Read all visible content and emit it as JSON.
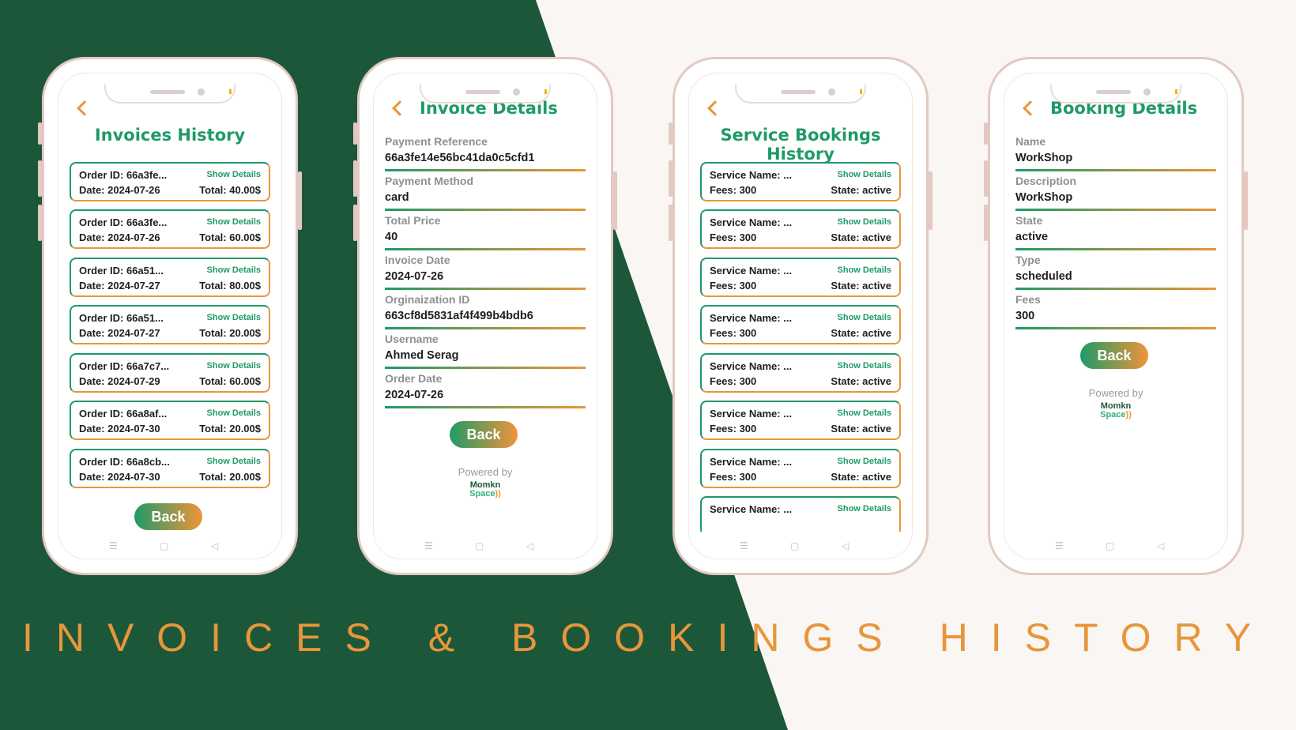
{
  "headline": "INVOICES & BOOKINGS HISTORY",
  "invoices_history": {
    "title": "Invoices History",
    "action_label": "Show Details",
    "back_label": "Back",
    "items": [
      {
        "order": "Order ID: 66a3fe...",
        "date": "Date: 2024-07-26",
        "total": "Total: 40.00$"
      },
      {
        "order": "Order ID: 66a3fe...",
        "date": "Date: 2024-07-26",
        "total": "Total: 60.00$"
      },
      {
        "order": "Order ID: 66a51...",
        "date": "Date: 2024-07-27",
        "total": "Total: 80.00$"
      },
      {
        "order": "Order ID: 66a51...",
        "date": "Date: 2024-07-27",
        "total": "Total: 20.00$"
      },
      {
        "order": "Order ID: 66a7c7...",
        "date": "Date: 2024-07-29",
        "total": "Total: 60.00$"
      },
      {
        "order": "Order ID: 66a8af...",
        "date": "Date: 2024-07-30",
        "total": "Total: 20.00$"
      },
      {
        "order": "Order ID: 66a8cb...",
        "date": "Date: 2024-07-30",
        "total": "Total: 20.00$"
      }
    ]
  },
  "invoice_details": {
    "title": "Invoice Details",
    "fields": [
      {
        "label": "Payment Reference",
        "value": "66a3fe14e56bc41da0c5cfd1"
      },
      {
        "label": "Payment Method",
        "value": "card"
      },
      {
        "label": "Total Price",
        "value": "40"
      },
      {
        "label": "Invoice Date",
        "value": "2024-07-26"
      },
      {
        "label": "Orginaization ID",
        "value": "663cf8d5831af4f499b4bdb6"
      },
      {
        "label": "Username",
        "value": "Ahmed Serag"
      },
      {
        "label": "Order Date",
        "value": "2024-07-26"
      }
    ],
    "back_label": "Back",
    "powered_by": "Powered by",
    "logo_top": "Momkn",
    "logo_bottom": "Space"
  },
  "service_bookings": {
    "title": "Service Bookings History",
    "action_label": "Show Details",
    "items": [
      {
        "name": "Service Name: ...",
        "fees": "Fees: 300",
        "state": "State: active"
      },
      {
        "name": "Service Name: ...",
        "fees": "Fees: 300",
        "state": "State: active"
      },
      {
        "name": "Service Name: ...",
        "fees": "Fees: 300",
        "state": "State: active"
      },
      {
        "name": "Service Name: ...",
        "fees": "Fees: 300",
        "state": "State: active"
      },
      {
        "name": "Service Name: ...",
        "fees": "Fees: 300",
        "state": "State: active"
      },
      {
        "name": "Service Name: ...",
        "fees": "Fees: 300",
        "state": "State: active"
      },
      {
        "name": "Service Name: ...",
        "fees": "Fees: 300",
        "state": "State: active"
      },
      {
        "name": "Service Name: ...",
        "fees": "",
        "state": ""
      }
    ]
  },
  "booking_details": {
    "title": "Booking Details",
    "fields": [
      {
        "label": "Name",
        "value": "WorkShop"
      },
      {
        "label": "Description",
        "value": "WorkShop"
      },
      {
        "label": "State",
        "value": "active"
      },
      {
        "label": "Type",
        "value": "scheduled"
      },
      {
        "label": "Fees",
        "value": "300"
      }
    ],
    "back_label": "Back",
    "powered_by": "Powered by",
    "logo_top": "Momkn",
    "logo_bottom": "Space"
  },
  "colors": {
    "dark_green": "#1c573a",
    "brand_green": "#1f9a67",
    "accent_orange": "#e8963a",
    "background": "#f9f6f3"
  }
}
